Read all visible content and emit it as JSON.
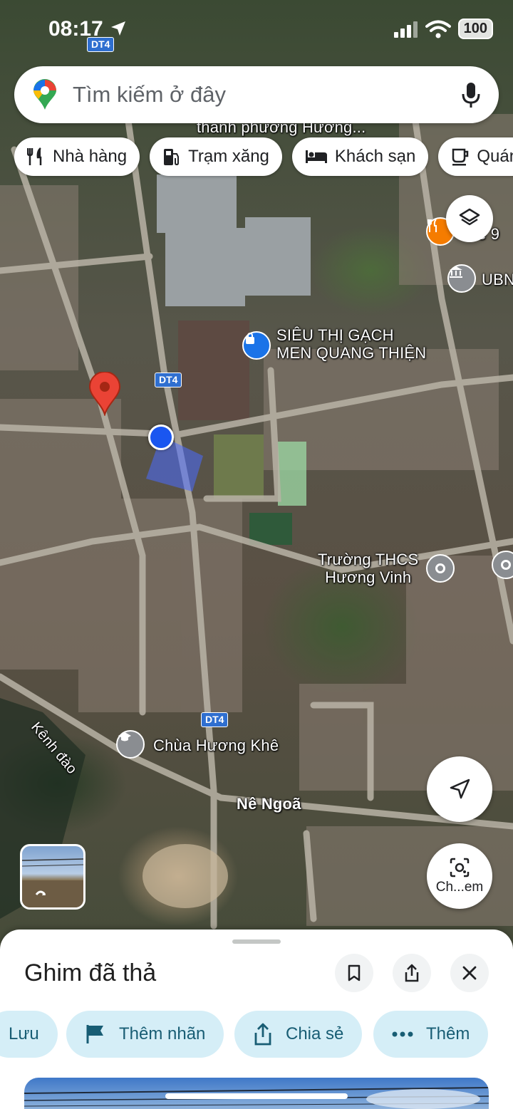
{
  "status_bar": {
    "time": "08:17",
    "battery": "100"
  },
  "search": {
    "placeholder": "Tìm kiếm ở đây",
    "icons": [
      "maps-pin-logo",
      "microphone-icon"
    ]
  },
  "chips": [
    {
      "label": "Nhà hàng",
      "icon": "fork-knife-icon"
    },
    {
      "label": "Trạm xăng",
      "icon": "gas-station-icon"
    },
    {
      "label": "Khách sạn",
      "icon": "bed-icon"
    },
    {
      "label": "Quán",
      "icon": "coffee-cup-icon"
    }
  ],
  "map": {
    "labels": {
      "top_partial": "thành phường Hương...",
      "sieu_thi": "SIÊU THỊ GẠCH\nMEN QUANG THIỆN",
      "truong": "Trường THCS\nHương Vinh",
      "chua": "Chùa Hương Khê",
      "kenh_dao": "Kênh đào",
      "ne_ngoa": "Nê Ngoã",
      "ubn": "UBN",
      "restaurant_partial": "e 9"
    },
    "road_shields": [
      "DT4",
      "DT4",
      "DT4"
    ],
    "poi_colors": {
      "shopping": "#1a73e8",
      "school": "#5f6368",
      "food": "#f57c00",
      "gov": "#5f6368"
    },
    "dropped_pin_color": "#ea4335",
    "my_location_color": "#1a56f0"
  },
  "floating": {
    "layers_icon": "layers-icon",
    "recenter_icon": "navigation-arrow-icon",
    "lens_label": "Ch...em",
    "lens_icon": "camera-search-icon"
  },
  "sheet": {
    "title": "Ghim đã thả",
    "actions": [
      {
        "label": "Lưu",
        "icon": ""
      },
      {
        "label": "Thêm nhãn",
        "icon": "flag-icon"
      },
      {
        "label": "Chia sẻ",
        "icon": "share-icon"
      },
      {
        "label": "Thêm",
        "icon": "more-dots-icon"
      }
    ]
  }
}
